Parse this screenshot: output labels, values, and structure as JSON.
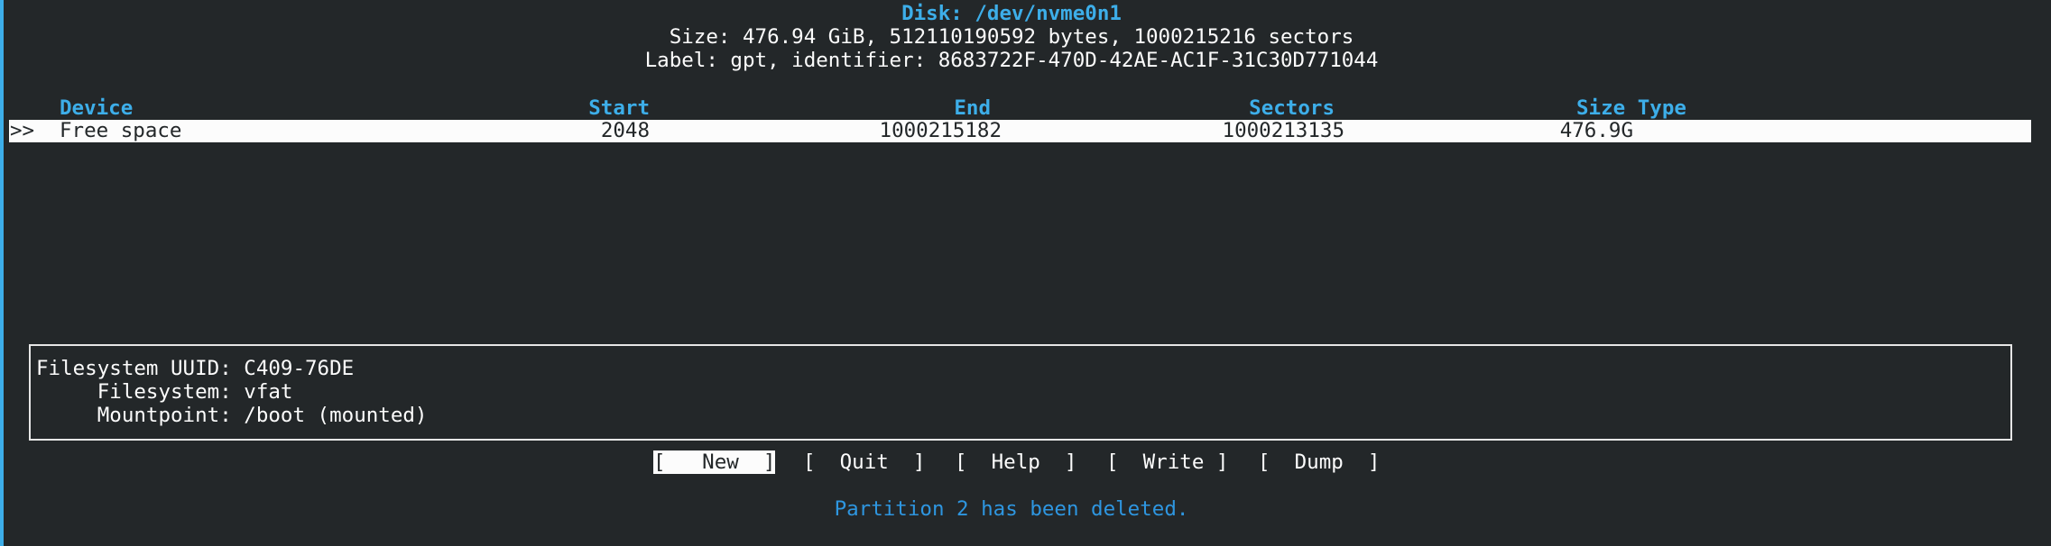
{
  "disk": {
    "title": "Disk: /dev/nvme0n1",
    "size_line": "Size: 476.94 GiB, 512110190592 bytes, 1000215216 sectors",
    "label_line": "Label: gpt, identifier: 8683722F-470D-42AE-AC1F-31C30D771044"
  },
  "table": {
    "headers": {
      "device": "Device",
      "start": "Start",
      "end": "End",
      "sectors": "Sectors",
      "size_type": "Size Type"
    },
    "rows": [
      {
        "cursor": ">>",
        "device": "Free space",
        "start": "2048",
        "end": "1000215182",
        "sectors": "1000213135",
        "size": "476.9G",
        "type": ""
      }
    ]
  },
  "info": {
    "uuid_line": "Filesystem UUID: C409-76DE",
    "filesystem_line": "     Filesystem: vfat",
    "mountpoint_line": "     Mountpoint: /boot (mounted)"
  },
  "menu": {
    "selected": "New",
    "buttons": [
      {
        "label": "[   New  ]"
      },
      {
        "label": "[  Quit  ]"
      },
      {
        "label": "[  Help  ]"
      },
      {
        "label": "[  Write ]"
      },
      {
        "label": "[  Dump  ]"
      }
    ]
  },
  "status": {
    "message": "Partition 2 has been deleted."
  },
  "colors": {
    "background": "#232729",
    "accent": "#3daee9",
    "text": "#fcfcfc",
    "selection_bg": "#fcfcfc",
    "status_text": "#2e96e0"
  }
}
